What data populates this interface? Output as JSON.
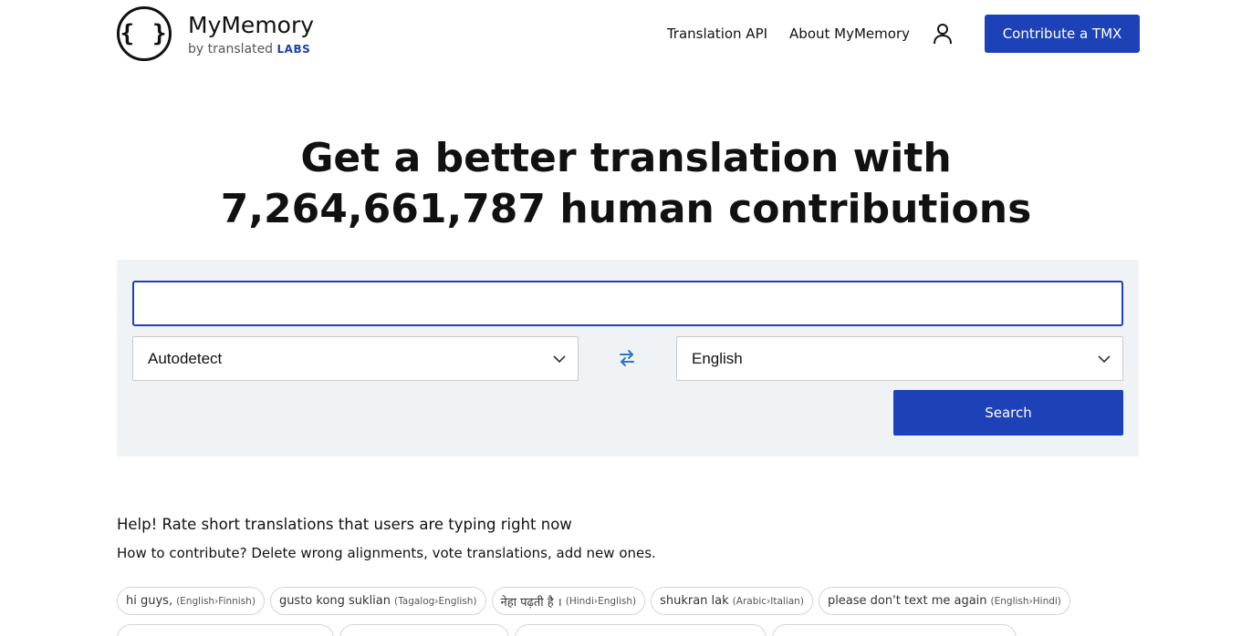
{
  "header": {
    "logo_glyph": "{ }",
    "brand_name": "MyMemory",
    "brand_by": "by translated",
    "brand_labs": "LABS",
    "nav": [
      {
        "label": "Translation API"
      },
      {
        "label": "About MyMemory"
      }
    ],
    "account_icon": "user-icon",
    "contribute_label": "Contribute a TMX"
  },
  "headline": {
    "line1": "Get a better translation with",
    "line2": "7,264,661,787 human contributions"
  },
  "search": {
    "query_value": "",
    "source_language": "Autodetect",
    "target_language": "English",
    "swap_icon": "swap-arrows-icon",
    "button_label": "Search",
    "accent_color": "#1d42b8"
  },
  "help": {
    "title": "Help! Rate short translations that users are typing right now",
    "subtitle": "How to contribute? Delete wrong alignments, vote translations, add new ones."
  },
  "recent": [
    {
      "text": "hi guys,",
      "pair": "(English›Finnish)"
    },
    {
      "text": "gusto kong suklian",
      "pair": "(Tagalog›English)"
    },
    {
      "text": "नेहा पढ़ती है ।",
      "pair": "(Hindi›English)"
    },
    {
      "text": "shukran lak",
      "pair": "(Arabic›Italian)"
    },
    {
      "text": "please don't text me again",
      "pair": "(English›Hindi)"
    }
  ]
}
